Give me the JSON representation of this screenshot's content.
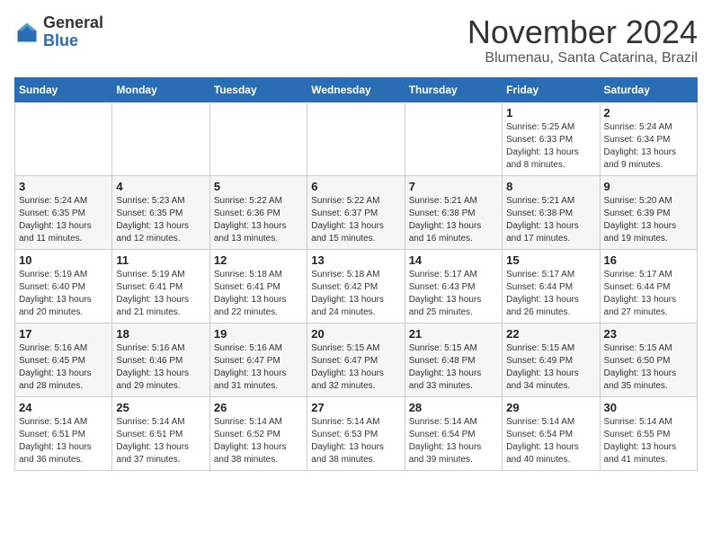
{
  "logo": {
    "general": "General",
    "blue": "Blue"
  },
  "title": "November 2024",
  "subtitle": "Blumenau, Santa Catarina, Brazil",
  "days_of_week": [
    "Sunday",
    "Monday",
    "Tuesday",
    "Wednesday",
    "Thursday",
    "Friday",
    "Saturday"
  ],
  "weeks": [
    [
      {
        "day": "",
        "info": ""
      },
      {
        "day": "",
        "info": ""
      },
      {
        "day": "",
        "info": ""
      },
      {
        "day": "",
        "info": ""
      },
      {
        "day": "",
        "info": ""
      },
      {
        "day": "1",
        "info": "Sunrise: 5:25 AM\nSunset: 6:33 PM\nDaylight: 13 hours\nand 8 minutes."
      },
      {
        "day": "2",
        "info": "Sunrise: 5:24 AM\nSunset: 6:34 PM\nDaylight: 13 hours\nand 9 minutes."
      }
    ],
    [
      {
        "day": "3",
        "info": "Sunrise: 5:24 AM\nSunset: 6:35 PM\nDaylight: 13 hours\nand 11 minutes."
      },
      {
        "day": "4",
        "info": "Sunrise: 5:23 AM\nSunset: 6:35 PM\nDaylight: 13 hours\nand 12 minutes."
      },
      {
        "day": "5",
        "info": "Sunrise: 5:22 AM\nSunset: 6:36 PM\nDaylight: 13 hours\nand 13 minutes."
      },
      {
        "day": "6",
        "info": "Sunrise: 5:22 AM\nSunset: 6:37 PM\nDaylight: 13 hours\nand 15 minutes."
      },
      {
        "day": "7",
        "info": "Sunrise: 5:21 AM\nSunset: 6:38 PM\nDaylight: 13 hours\nand 16 minutes."
      },
      {
        "day": "8",
        "info": "Sunrise: 5:21 AM\nSunset: 6:38 PM\nDaylight: 13 hours\nand 17 minutes."
      },
      {
        "day": "9",
        "info": "Sunrise: 5:20 AM\nSunset: 6:39 PM\nDaylight: 13 hours\nand 19 minutes."
      }
    ],
    [
      {
        "day": "10",
        "info": "Sunrise: 5:19 AM\nSunset: 6:40 PM\nDaylight: 13 hours\nand 20 minutes."
      },
      {
        "day": "11",
        "info": "Sunrise: 5:19 AM\nSunset: 6:41 PM\nDaylight: 13 hours\nand 21 minutes."
      },
      {
        "day": "12",
        "info": "Sunrise: 5:18 AM\nSunset: 6:41 PM\nDaylight: 13 hours\nand 22 minutes."
      },
      {
        "day": "13",
        "info": "Sunrise: 5:18 AM\nSunset: 6:42 PM\nDaylight: 13 hours\nand 24 minutes."
      },
      {
        "day": "14",
        "info": "Sunrise: 5:17 AM\nSunset: 6:43 PM\nDaylight: 13 hours\nand 25 minutes."
      },
      {
        "day": "15",
        "info": "Sunrise: 5:17 AM\nSunset: 6:44 PM\nDaylight: 13 hours\nand 26 minutes."
      },
      {
        "day": "16",
        "info": "Sunrise: 5:17 AM\nSunset: 6:44 PM\nDaylight: 13 hours\nand 27 minutes."
      }
    ],
    [
      {
        "day": "17",
        "info": "Sunrise: 5:16 AM\nSunset: 6:45 PM\nDaylight: 13 hours\nand 28 minutes."
      },
      {
        "day": "18",
        "info": "Sunrise: 5:16 AM\nSunset: 6:46 PM\nDaylight: 13 hours\nand 29 minutes."
      },
      {
        "day": "19",
        "info": "Sunrise: 5:16 AM\nSunset: 6:47 PM\nDaylight: 13 hours\nand 31 minutes."
      },
      {
        "day": "20",
        "info": "Sunrise: 5:15 AM\nSunset: 6:47 PM\nDaylight: 13 hours\nand 32 minutes."
      },
      {
        "day": "21",
        "info": "Sunrise: 5:15 AM\nSunset: 6:48 PM\nDaylight: 13 hours\nand 33 minutes."
      },
      {
        "day": "22",
        "info": "Sunrise: 5:15 AM\nSunset: 6:49 PM\nDaylight: 13 hours\nand 34 minutes."
      },
      {
        "day": "23",
        "info": "Sunrise: 5:15 AM\nSunset: 6:50 PM\nDaylight: 13 hours\nand 35 minutes."
      }
    ],
    [
      {
        "day": "24",
        "info": "Sunrise: 5:14 AM\nSunset: 6:51 PM\nDaylight: 13 hours\nand 36 minutes."
      },
      {
        "day": "25",
        "info": "Sunrise: 5:14 AM\nSunset: 6:51 PM\nDaylight: 13 hours\nand 37 minutes."
      },
      {
        "day": "26",
        "info": "Sunrise: 5:14 AM\nSunset: 6:52 PM\nDaylight: 13 hours\nand 38 minutes."
      },
      {
        "day": "27",
        "info": "Sunrise: 5:14 AM\nSunset: 6:53 PM\nDaylight: 13 hours\nand 38 minutes."
      },
      {
        "day": "28",
        "info": "Sunrise: 5:14 AM\nSunset: 6:54 PM\nDaylight: 13 hours\nand 39 minutes."
      },
      {
        "day": "29",
        "info": "Sunrise: 5:14 AM\nSunset: 6:54 PM\nDaylight: 13 hours\nand 40 minutes."
      },
      {
        "day": "30",
        "info": "Sunrise: 5:14 AM\nSunset: 6:55 PM\nDaylight: 13 hours\nand 41 minutes."
      }
    ]
  ]
}
